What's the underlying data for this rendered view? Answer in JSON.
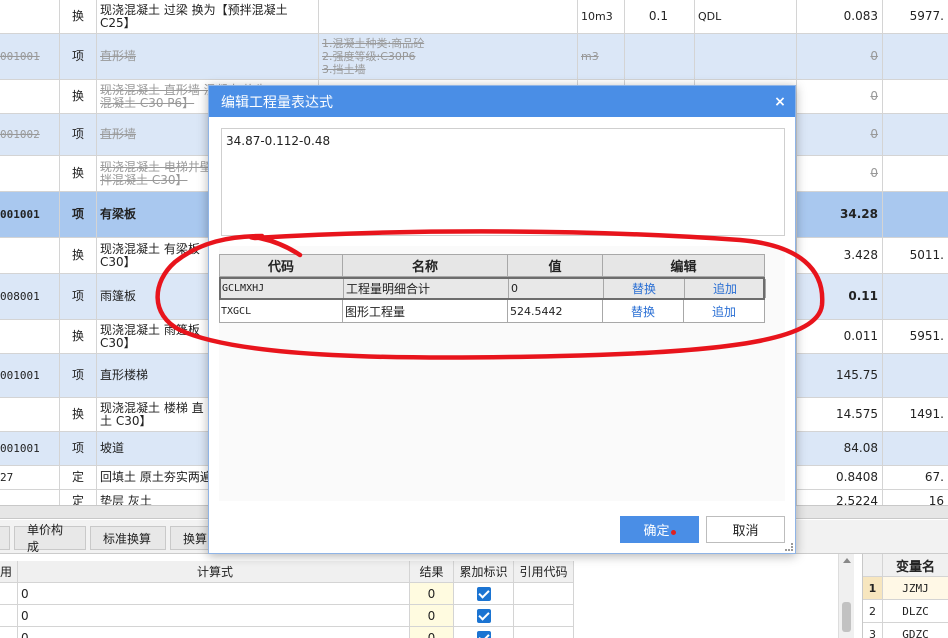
{
  "grid": {
    "rows": [
      {
        "code": "",
        "type": "换",
        "name": "现浇混凝土 过梁  换为【预拌混凝土\nC25】",
        "feature": "",
        "unit": "10m3",
        "qty": "0.1",
        "expr": "QDL",
        "value": "0.083",
        "price": "5977."
      },
      {
        "code": "001001",
        "type": "项",
        "name": "直形墙",
        "feature": "1.混凝土种类:商品砼\n2.强度等级:C30P6\n3.挡土墙",
        "unit": "m3",
        "qty": "",
        "expr": "",
        "value": "0",
        "price": ""
      },
      {
        "code": "",
        "type": "换",
        "name": "现浇混凝土 直形墙 混凝土  换为\n混凝土 C30 P6】",
        "feature": "",
        "unit": "",
        "qty": "",
        "expr": "",
        "value": "0",
        "price": ""
      },
      {
        "code": "001002",
        "type": "项",
        "name": "直形墙",
        "feature": "",
        "unit": "",
        "qty": "",
        "expr": "",
        "value": "0",
        "price": ""
      },
      {
        "code": "",
        "type": "换",
        "name": "现浇混凝土 电梯井壁\n拌混凝土 C30】",
        "feature": "",
        "unit": "",
        "qty": "",
        "expr": "",
        "value": "0",
        "price": ""
      },
      {
        "code": "001001",
        "type": "项",
        "name": "有梁板",
        "feature": "",
        "unit": "",
        "qty": "",
        "expr": "",
        "value": "34.28",
        "price": ""
      },
      {
        "code": "",
        "type": "换",
        "name": "现浇混凝土 有梁板\nC30】",
        "feature": "",
        "unit": "",
        "qty": "",
        "expr": "",
        "value": "3.428",
        "price": "5011."
      },
      {
        "code": "008001",
        "type": "项",
        "name": "雨篷板",
        "feature": "",
        "unit": "",
        "qty": "",
        "expr": "",
        "value": "0.11",
        "price": ""
      },
      {
        "code": "",
        "type": "换",
        "name": "现浇混凝土 雨篷板\nC30】",
        "feature": "",
        "unit": "",
        "qty": "",
        "expr": "",
        "value": "0.011",
        "price": "5951."
      },
      {
        "code": "001001",
        "type": "项",
        "name": "直形楼梯",
        "feature": "",
        "unit": "",
        "qty": "",
        "expr": "",
        "value": "145.75",
        "price": ""
      },
      {
        "code": "",
        "type": "换",
        "name": "现浇混凝土 楼梯 直\n土 C30】",
        "feature": "",
        "unit": "",
        "qty": "",
        "expr": "",
        "value": "14.575",
        "price": "1491."
      },
      {
        "code": "001001",
        "type": "项",
        "name": "坡道",
        "feature": "",
        "unit": "",
        "qty": "",
        "expr": "",
        "value": "84.08",
        "price": ""
      },
      {
        "code": "27",
        "type": "定",
        "name": "回填土 原土夯实两遍",
        "feature": "",
        "unit": "",
        "qty": "",
        "expr": "",
        "value": "0.8408",
        "price": "67."
      },
      {
        "code": "",
        "type": "定",
        "name": "垫层 灰土",
        "feature": "",
        "unit": "",
        "qty": "",
        "expr": "",
        "value": "2.5224",
        "price": "16"
      }
    ]
  },
  "bottom_tabs": [
    "",
    "单价构成",
    "标准换算",
    "换算"
  ],
  "calc_table": {
    "headers": [
      "用",
      "计算式",
      "结果",
      "累加标识",
      "引用代码"
    ],
    "rows": [
      {
        "expr": "0",
        "result": "0",
        "checked": true
      },
      {
        "expr": "0",
        "result": "0",
        "checked": true
      },
      {
        "expr": "0",
        "result": "0",
        "checked": true
      }
    ]
  },
  "var_table": {
    "header": "变量名",
    "rows": [
      {
        "idx": "1",
        "name": "JZMJ"
      },
      {
        "idx": "2",
        "name": "DLZC"
      },
      {
        "idx": "3",
        "name": "GDZC"
      }
    ]
  },
  "dialog": {
    "title": "编辑工程量表达式",
    "close_glyph": "×",
    "expression": "34.87-0.112-0.48",
    "table_headers": {
      "code": "代码",
      "name": "名称",
      "value": "值",
      "edit": "编辑"
    },
    "rows": [
      {
        "code": "GCLMXHJ",
        "name": "工程量明细合计",
        "value": "0",
        "replace": "替换",
        "add": "追加"
      },
      {
        "code": "TXGCL",
        "name": "图形工程量",
        "value": "524.5442",
        "replace": "替换",
        "add": "追加"
      }
    ],
    "ok_label": "确定",
    "cancel_label": "取消"
  },
  "colors": {
    "dialog_title_bg": "#4a8ee6",
    "selected_row_bg": "#a9c8ef",
    "annotation": "#e8141c",
    "link_blue": "#2a6fd4"
  },
  "icons": {
    "close": "close-icon",
    "check": "checkbox-checked-icon"
  }
}
